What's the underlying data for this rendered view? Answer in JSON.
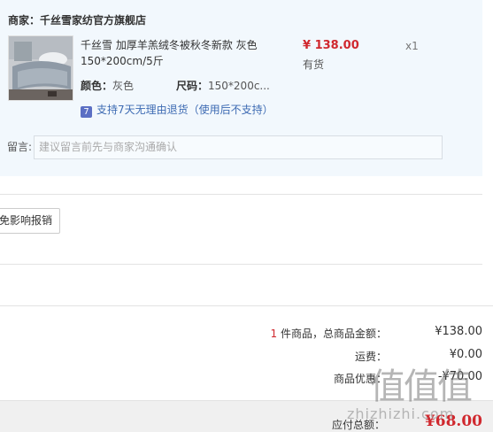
{
  "shop": {
    "label": "商家：",
    "name": "千丝雪家纺官方旗舰店"
  },
  "product": {
    "title": "千丝雪 加厚羊羔绒冬被秋冬新款 灰色150*200cm/5斤",
    "color_label": "颜色：",
    "color_value": "灰色",
    "size_label": "尺码：",
    "size_value": "150*200c...",
    "service_icon": "7",
    "service_text": "支持7天无理由退货（使用后不支持）",
    "price": "¥ 138.00",
    "stock": "有货",
    "quantity": "x1"
  },
  "memo": {
    "label": "留言:",
    "placeholder": "建议留言前先与商家沟通确认"
  },
  "invoice_button": "免影响报销",
  "summary": {
    "count": "1",
    "count_suffix": "件商品，总商品金额：",
    "goods_amount": "¥138.00",
    "shipping_label": "运费：",
    "shipping_value": "¥0.00",
    "discount_label": "商品优惠：",
    "discount_value": "-¥70.00",
    "total_label": "应付总额：",
    "total_value": "¥68.00"
  },
  "watermark": {
    "glyphs": "值值值",
    "site": "zhizhizhi.com"
  },
  "colors": {
    "accent_red": "#d0282e",
    "panel_bg": "#f2f8fd",
    "link_blue": "#3e6bb3"
  }
}
